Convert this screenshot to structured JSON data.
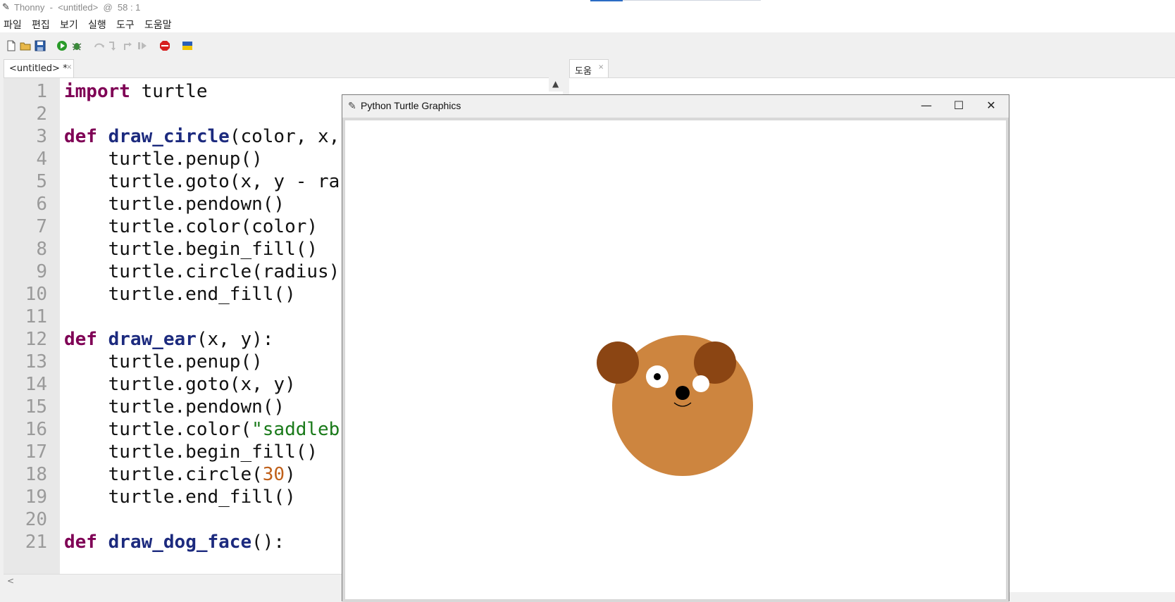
{
  "window": {
    "title": "Thonny  -  <untitled>  @  58 : 1",
    "icon": "feather-icon"
  },
  "menu": {
    "items": [
      "파일",
      "편집",
      "보기",
      "실행",
      "도구",
      "도움말"
    ]
  },
  "toolbar": {
    "icons": [
      "new-file-icon",
      "open-file-icon",
      "save-icon",
      "run-icon",
      "debug-icon",
      "step-over-icon",
      "step-into-icon",
      "step-out-icon",
      "resume-icon",
      "stop-icon",
      "ukraine-flag-icon"
    ]
  },
  "editor": {
    "tab_label": "<untitled> *",
    "tab_close": "×",
    "lines": [
      {
        "n": "1"
      },
      {
        "n": "2"
      },
      {
        "n": "3"
      },
      {
        "n": "4"
      },
      {
        "n": "5"
      },
      {
        "n": "6"
      },
      {
        "n": "7"
      },
      {
        "n": "8"
      },
      {
        "n": "9"
      },
      {
        "n": "10"
      },
      {
        "n": "11"
      },
      {
        "n": "12"
      },
      {
        "n": "13"
      },
      {
        "n": "14"
      },
      {
        "n": "15"
      },
      {
        "n": "16"
      },
      {
        "n": "17"
      },
      {
        "n": "18"
      },
      {
        "n": "19"
      },
      {
        "n": "20"
      },
      {
        "n": "21"
      }
    ],
    "code": {
      "l1_kw": "import",
      "l1_rest": " turtle",
      "l3_kw": "def",
      "l3_fn": "draw_circle",
      "l3_rest": "(color, x,",
      "l4": "    turtle.penup()",
      "l5": "    turtle.goto(x, y - ra",
      "l6": "    turtle.pendown()",
      "l7": "    turtle.color(color)",
      "l8": "    turtle.begin_fill()",
      "l9": "    turtle.circle(radius)",
      "l10": "    turtle.end_fill()",
      "l12_kw": "def",
      "l12_fn": "draw_ear",
      "l12_rest": "(x, y):",
      "l13": "    turtle.penup()",
      "l14": "    turtle.goto(x, y)",
      "l15": "    turtle.pendown()",
      "l16_a": "    turtle.color(",
      "l16_str": "\"saddleb",
      "l17": "    turtle.begin_fill()",
      "l18_a": "    turtle.circle(",
      "l18_num": "30",
      "l18_b": ")",
      "l19": "    turtle.end_fill()",
      "l21_kw": "def",
      "l21_fn": "draw_dog_face",
      "l21_rest": "():"
    }
  },
  "help": {
    "tab_label": "도움",
    "tab_close": "×"
  },
  "turtle_window": {
    "title": "Python Turtle Graphics",
    "minimize": "—",
    "maximize": "☐",
    "close": "✕",
    "colors": {
      "face": "#cd853f",
      "ear": "#8b4513",
      "eye": "#ffffff",
      "pupil": "#000000",
      "nose": "#000000"
    }
  }
}
